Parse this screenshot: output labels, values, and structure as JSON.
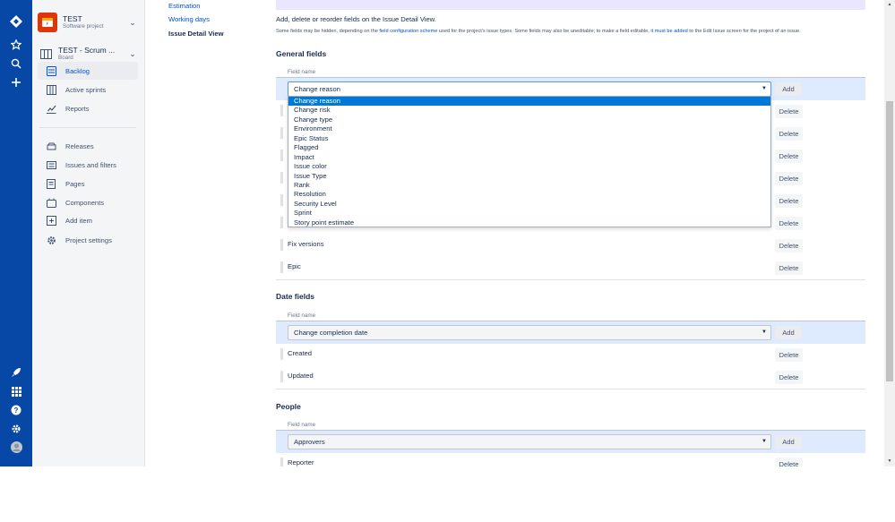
{
  "project": {
    "name": "TEST",
    "type": "Software project"
  },
  "board": {
    "name": "TEST - Scrum ...",
    "type": "Board"
  },
  "sidebar": {
    "items": [
      {
        "label": "Backlog"
      },
      {
        "label": "Active sprints"
      },
      {
        "label": "Reports"
      },
      {
        "label": "Releases"
      },
      {
        "label": "Issues and filters"
      },
      {
        "label": "Pages"
      },
      {
        "label": "Components"
      },
      {
        "label": "Add item"
      },
      {
        "label": "Project settings"
      }
    ]
  },
  "settings_nav": {
    "estimation": "Estimation",
    "working_days": "Working days",
    "current": "Issue Detail View"
  },
  "main": {
    "intro": "Add, delete or reorder fields on the Issue Detail View.",
    "note_pre": "Some fields may be hidden, depending on the ",
    "note_link1": "field configuration scheme",
    "note_mid": " used for the project's issue types. Some fields may also be uneditable; to make a field editable, ",
    "note_link2": "it must be added",
    "note_post": " to the Edit Issue screen for the project of an issue.",
    "field_name_label": "Field name",
    "add_label": "Add",
    "delete_label": "Delete"
  },
  "general": {
    "title": "General fields",
    "selected": "Change reason",
    "options": [
      "Change reason",
      "Change risk",
      "Change type",
      "Environment",
      "Epic Status",
      "Flagged",
      "Impact",
      "Issue color",
      "Issue Type",
      "Rank",
      "Resolution",
      "Security Level",
      "Sprint",
      "Story point estimate"
    ],
    "visible_fields": [
      "Fix versions",
      "Epic"
    ]
  },
  "date_fields": {
    "title": "Date fields",
    "selected": "Change completion date",
    "fields": [
      "Created",
      "Updated"
    ]
  },
  "people": {
    "title": "People",
    "selected": "Approvers",
    "fields": [
      "Reporter"
    ]
  },
  "colors": {
    "global_nav": "#0747a6",
    "accent": "#0052cc",
    "add_row_bg": "#deebff",
    "dropdown_highlight": "#0078d7"
  },
  "icons": [
    "jira-logo-icon",
    "star-icon",
    "search-icon",
    "plus-icon",
    "rocket-icon",
    "app-switcher-icon",
    "help-icon",
    "settings-icon",
    "user-avatar",
    "backlog-icon",
    "board-icon",
    "reports-icon",
    "releases-icon",
    "issues-icon",
    "pages-icon",
    "components-icon",
    "add-item-icon",
    "settings-gear-icon"
  ]
}
